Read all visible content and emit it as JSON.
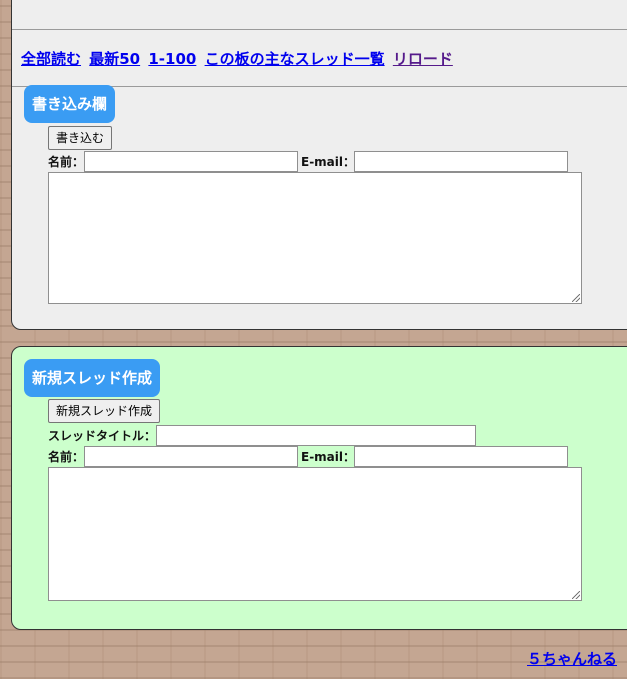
{
  "nav": {
    "links": [
      {
        "label": "全部読む"
      },
      {
        "label": "最新50"
      },
      {
        "label": "1-100"
      },
      {
        "label": "この板の主なスレッド一覧"
      },
      {
        "label": "リロード"
      }
    ]
  },
  "reply_form": {
    "heading": "書き込み欄",
    "submit_label": "書き込む",
    "name_label": "名前：",
    "name_value": "",
    "email_label": "E-mail：",
    "email_value": "",
    "message_value": ""
  },
  "new_thread_form": {
    "heading": "新規スレッド作成",
    "submit_label": "新規スレッド作成",
    "title_label": "スレッドタイトル：",
    "title_value": "",
    "name_label": "名前：",
    "name_value": "",
    "email_label": "E-mail：",
    "email_value": "",
    "message_value": ""
  },
  "footer": {
    "site_link": "５ちゃんねる"
  },
  "colors": {
    "reply_panel_bg": "#eeeeee",
    "new_thread_panel_bg": "#ccffcc",
    "heading_pill": "#3a9cf3",
    "link": "#0000ee",
    "visited_link": "#551a8b",
    "page_bg": "#c4a692"
  }
}
